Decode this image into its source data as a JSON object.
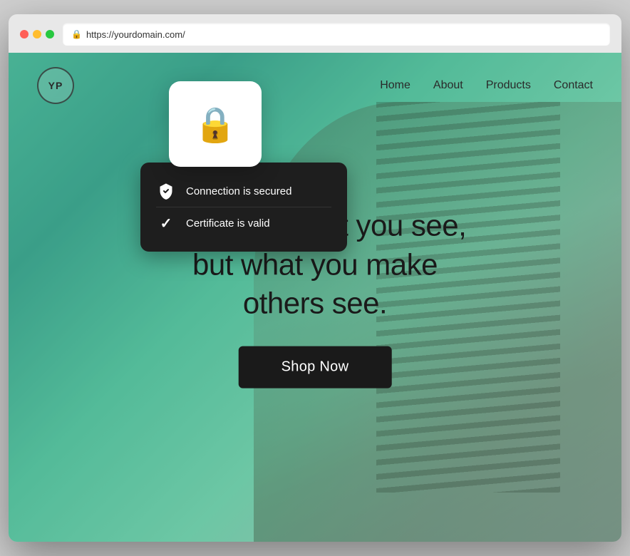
{
  "browser": {
    "traffic_lights": [
      "red",
      "yellow",
      "green"
    ],
    "address": "https://yourdomain.com/"
  },
  "security_popup": {
    "lock_icon": "🔒",
    "items": [
      {
        "icon_type": "shield",
        "text": "Connection is secured"
      },
      {
        "icon_type": "check",
        "text": "Certificate is valid"
      }
    ]
  },
  "website": {
    "logo": "YP",
    "nav_links": [
      "Home",
      "About",
      "Products",
      "Contact"
    ],
    "hero_title": "Art is not what you see,\nbut what you make\nothers see.",
    "shop_button": "Shop Now"
  }
}
